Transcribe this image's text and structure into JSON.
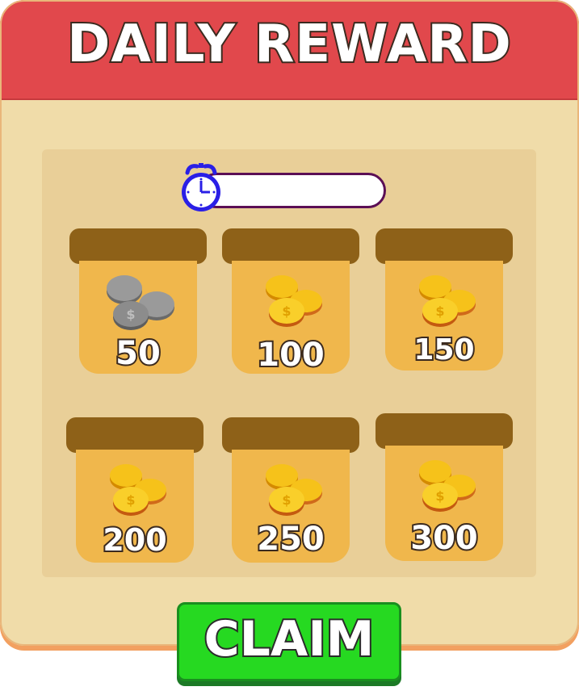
{
  "header": {
    "title": "DAILY REWARD"
  },
  "timer": {
    "value": ""
  },
  "rewards": [
    {
      "amount": "50",
      "coin": "silver"
    },
    {
      "amount": "100",
      "coin": "gold"
    },
    {
      "amount": "150",
      "coin": "gold"
    },
    {
      "amount": "200",
      "coin": "gold"
    },
    {
      "amount": "250",
      "coin": "gold"
    },
    {
      "amount": "300",
      "coin": "gold"
    }
  ],
  "claim": {
    "label": "CLAIM"
  },
  "colors": {
    "header": "#e1484c",
    "panel": "#f0dca9",
    "card_lid": "#8e6118",
    "card_body": "#f0b74c",
    "claim_button": "#26d921",
    "timer_border": "#5b0f55",
    "clock": "#2a1fe6"
  }
}
